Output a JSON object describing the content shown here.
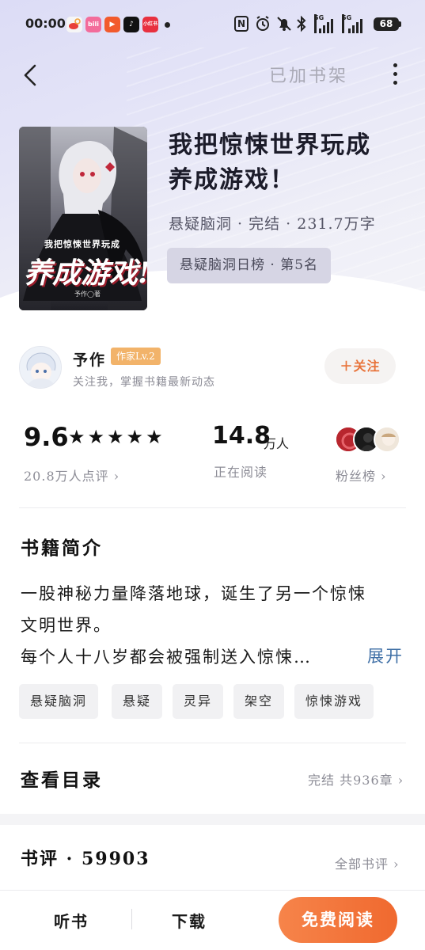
{
  "status_bar": {
    "time": "00:00",
    "battery": "68",
    "signal_1_label": "5G",
    "signal_2_label": "5G",
    "notification_apps": [
      {
        "icon": "weibo-icon",
        "color": "#f2b33d",
        "text": ""
      },
      {
        "icon": "bilibili-icon",
        "color": "#f36c9b",
        "text": "bili"
      },
      {
        "icon": "video-app-icon",
        "color": "#f25a2c",
        "text": "▶"
      },
      {
        "icon": "tiktok-icon",
        "color": "#111111",
        "text": "♪"
      },
      {
        "icon": "xiaohongshu-icon",
        "color": "#e8303f",
        "text": "小红书"
      }
    ],
    "system_icons": [
      "nfc-icon",
      "alarm-icon",
      "mute-icon",
      "bluetooth-icon",
      "signal-icon",
      "signal-icon",
      "battery-icon"
    ]
  },
  "nav": {
    "back_icon": "chevron-left-icon",
    "shelf_status": "已加书架",
    "more_icon": "more-vertical-icon"
  },
  "book": {
    "title_line1": "我把惊悚世界玩成",
    "title_line2": "养成游戏！",
    "meta": "悬疑脑洞 · 完结 · 231.7万字",
    "rank": "悬疑脑洞日榜 · 第5名",
    "cover": {
      "small_title": "我把惊悚世界玩成",
      "big_title": "养成游戏!",
      "author_mark": "予作◯著"
    }
  },
  "author": {
    "name": "予作",
    "level": "作家Lv.2",
    "tip": "关注我，掌握书籍最新动态",
    "follow_label": "＋关注"
  },
  "stats": {
    "score": "9.6",
    "stars": "★★★★★",
    "rating_count": "20.8万人点评 ›",
    "reading_count": "14.8",
    "reading_unit": "万人",
    "reading_label": "正在阅读",
    "fans_label": "粉丝榜 ›"
  },
  "intro": {
    "heading": "书籍简介",
    "lines": [
      "一股神秘力量降落地球，诞生了另一个惊悚",
      "文明世界。",
      "每个人十八岁都会被强制送入惊悚…"
    ],
    "expand_label": "展开"
  },
  "tags": [
    "悬疑脑洞",
    "悬疑",
    "灵异",
    "架空",
    "惊悚游戏"
  ],
  "toc": {
    "heading": "查看目录",
    "status": "完结 共936章 ›"
  },
  "reviews": {
    "heading": "书评 · 59903",
    "all_label": "全部书评 ›"
  },
  "bottom_bar": {
    "listen_label": "听书",
    "download_label": "下载",
    "read_label": "免费阅读"
  },
  "colors": {
    "accent": "#f0692f",
    "link": "#3f6fa6",
    "author_badge": "#f2b36a"
  }
}
